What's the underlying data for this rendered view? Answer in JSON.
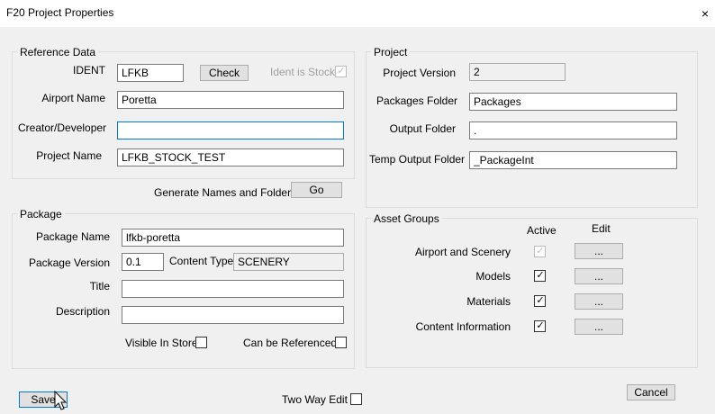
{
  "window": {
    "title": "F20 Project Properties",
    "close_glyph": "×"
  },
  "reference": {
    "legend": "Reference Data",
    "ident_label": "IDENT",
    "ident_value": "LFKB",
    "check_button": "Check",
    "ident_stock_label": "Ident is Stock",
    "ident_stock_checked": true,
    "airport_label": "Airport Name",
    "airport_value": "Poretta",
    "creator_label": "Creator/Developer",
    "creator_value": "",
    "project_name_label": "Project Name",
    "project_name_value": "LFKB_STOCK_TEST",
    "generate_label": "Generate Names and Folders",
    "go_button": "Go"
  },
  "project": {
    "legend": "Project",
    "version_label": "Project Version",
    "version_value": "2",
    "packages_label": "Packages Folder",
    "packages_value": "Packages",
    "output_label": "Output Folder",
    "output_value": ".",
    "temp_label": "Temp Output Folder",
    "temp_value": "_PackageInt"
  },
  "package": {
    "legend": "Package",
    "name_label": "Package Name",
    "name_value": "lfkb-poretta",
    "version_label": "Package Version",
    "version_value": "0.1",
    "content_type_label": "Content Type",
    "content_type_value": "SCENERY",
    "title_label": "Title",
    "title_value": "",
    "description_label": "Description",
    "description_value": "",
    "visible_label": "Visible In Store",
    "visible_checked": false,
    "referenced_label": "Can be Referenced",
    "referenced_checked": false
  },
  "asset_groups": {
    "legend": "Asset Groups",
    "active_header": "Active",
    "edit_header": "Edit",
    "rows": [
      {
        "label": "Airport and Scenery",
        "active": true,
        "enabled": false,
        "edit": "..."
      },
      {
        "label": "Models",
        "active": true,
        "enabled": true,
        "edit": "..."
      },
      {
        "label": "Materials",
        "active": true,
        "enabled": true,
        "edit": "..."
      },
      {
        "label": "Content Information",
        "active": true,
        "enabled": true,
        "edit": "..."
      }
    ]
  },
  "footer": {
    "save_button": "Save",
    "two_way_label": "Two Way Edit",
    "two_way_checked": false,
    "cancel_button": "Cancel"
  },
  "check_glyph": "✓",
  "icons": {
    "close": "close-icon",
    "cursor": "mouse-cursor-icon"
  }
}
